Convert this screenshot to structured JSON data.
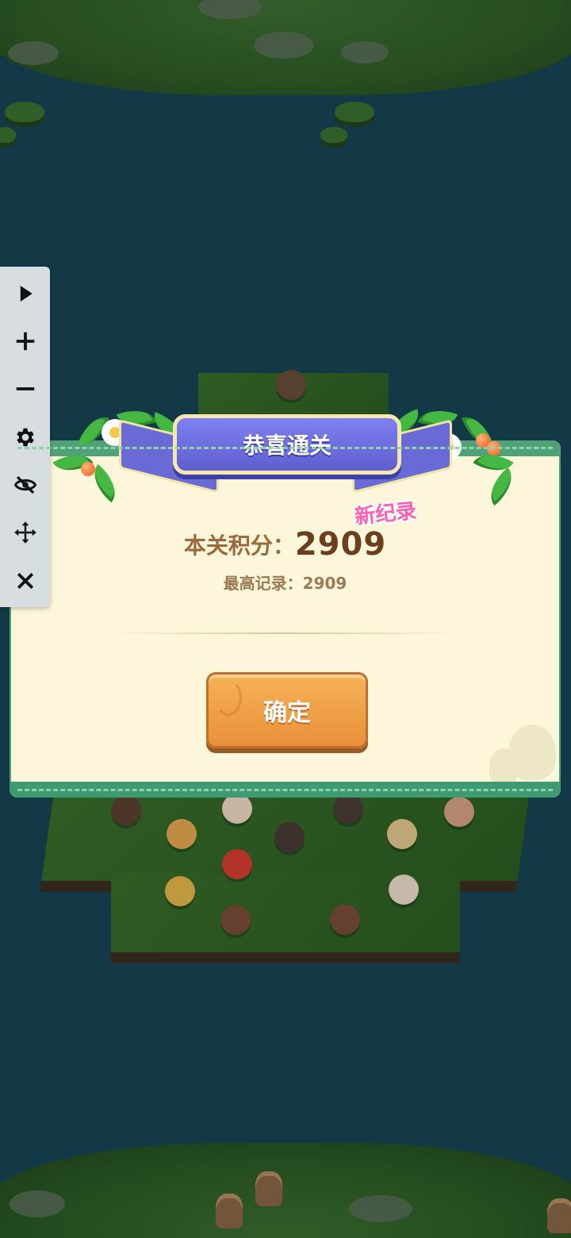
{
  "dialog": {
    "title": "恭喜通关",
    "score_label": "本关积分：",
    "score_value": "2909",
    "new_record_label": "新纪录",
    "best_label": "最高记录：",
    "best_value": "2909",
    "confirm_label": "确定"
  },
  "toolbar": {
    "items": [
      {
        "icon": "play-icon"
      },
      {
        "icon": "plus-icon"
      },
      {
        "icon": "minus-icon"
      },
      {
        "icon": "gear-icon"
      },
      {
        "icon": "eye-off-icon"
      },
      {
        "icon": "move-icon"
      },
      {
        "icon": "close-icon"
      }
    ]
  },
  "colors": {
    "water": "#174150",
    "dialog_bg": "#fdf6da",
    "dialog_border": "#4fa178",
    "ribbon": "#6f70e0",
    "button": "#ee9c43",
    "new_record": "#ff5fb1",
    "score_value": "#6b3e1c"
  }
}
